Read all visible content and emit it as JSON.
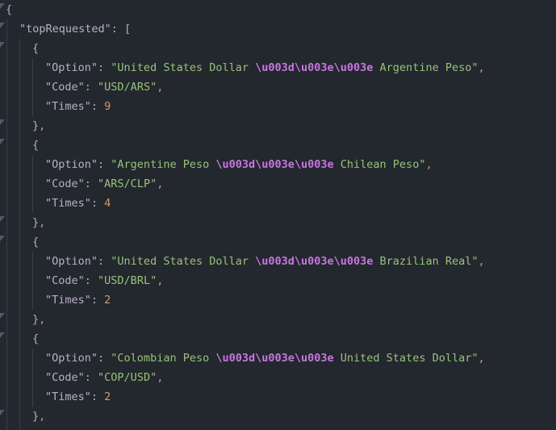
{
  "root_key": "\"topRequested\"",
  "items": [
    {
      "option_key": "\"Option\"",
      "option_part1": "\"United States Dollar ",
      "option_escape": "\\u003d\\u003e\\u003e",
      "option_part2": " Argentine Peso\"",
      "code_key": "\"Code\"",
      "code_value": "\"USD/ARS\"",
      "times_key": "\"Times\"",
      "times_value": "9"
    },
    {
      "option_key": "\"Option\"",
      "option_part1": "\"Argentine Peso ",
      "option_escape": "\\u003d\\u003e\\u003e",
      "option_part2": " Chilean Peso\"",
      "code_key": "\"Code\"",
      "code_value": "\"ARS/CLP\"",
      "times_key": "\"Times\"",
      "times_value": "4"
    },
    {
      "option_key": "\"Option\"",
      "option_part1": "\"United States Dollar ",
      "option_escape": "\\u003d\\u003e\\u003e",
      "option_part2": " Brazilian Real\"",
      "code_key": "\"Code\"",
      "code_value": "\"USD/BRL\"",
      "times_key": "\"Times\"",
      "times_value": "2"
    },
    {
      "option_key": "\"Option\"",
      "option_part1": "\"Colombian Peso ",
      "option_escape": "\\u003d\\u003e\\u003e",
      "option_part2": " United States Dollar\"",
      "code_key": "\"Code\"",
      "code_value": "\"COP/USD\"",
      "times_key": "\"Times\"",
      "times_value": "2"
    }
  ]
}
